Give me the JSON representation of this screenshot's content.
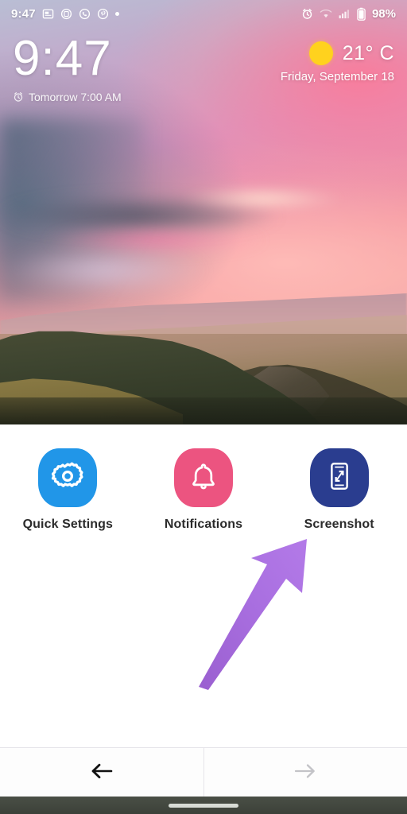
{
  "status_bar": {
    "time": "9:47",
    "battery_percent": "98%",
    "left_icons": [
      "news-icon",
      "message-circle-icon",
      "whatsapp-icon",
      "pinterest-icon",
      "notification-dot-icon"
    ],
    "right_icons": [
      "alarm-icon",
      "wifi-icon",
      "signal-icon",
      "battery-icon"
    ]
  },
  "clock_widget": {
    "time": "9:47",
    "alarm_icon": "alarm-clock-icon",
    "alarm_text": "Tomorrow 7:00 AM"
  },
  "weather_widget": {
    "icon": "sun-icon",
    "temperature": "21° C",
    "date": "Friday, September 18"
  },
  "shortcuts": [
    {
      "label": "Quick Settings",
      "icon": "gear-icon",
      "color": "#2196e8"
    },
    {
      "label": "Notifications",
      "icon": "bell-icon",
      "color": "#ec5480"
    },
    {
      "label": "Screenshot",
      "icon": "screenshot-phone-icon",
      "color": "#2a3d8f"
    }
  ],
  "annotation": {
    "arrow_icon": "arrow-up-right-icon",
    "color": "#a265d8",
    "points_to": "Screenshot"
  },
  "navbar": {
    "back": {
      "icon": "arrow-left-icon",
      "state": "enabled"
    },
    "forward": {
      "icon": "arrow-right-icon",
      "state": "disabled"
    }
  },
  "system": {
    "home_indicator": "home-indicator-bar"
  },
  "colors": {
    "quick_settings": "#2196e8",
    "notifications": "#ec5480",
    "screenshot": "#2a3d8f",
    "sun": "#ffd21e",
    "arrow": "#a265d8",
    "label_text": "#2b2b2b"
  }
}
